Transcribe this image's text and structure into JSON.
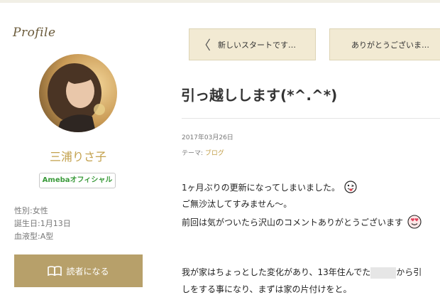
{
  "sidebar": {
    "heading": "Profile",
    "name": "三浦りさ子",
    "badge": "Amebaオフィシャル",
    "meta": [
      "性別:女性",
      "誕生日:1月13日",
      "血液型:A型"
    ],
    "follow_label": "読者になる",
    "follow_icon": "book-open-icon"
  },
  "nav": {
    "prev_label": "新しいスタートです…",
    "next_label": "ありがとうございま…",
    "prev_icon": "chevron-left-icon"
  },
  "post": {
    "title": "引っ越しします(*^.^*)",
    "date": "2017年03月26日",
    "theme_label": "テーマ:",
    "theme_link": "ブログ",
    "lines": [
      "1ヶ月ぶりの更新になってしまいました。",
      "ご無沙汰してすみません〜。",
      "前回は気がついたら沢山のコメントありがとうございます"
    ],
    "para2_a": "我が家はちょっとした変化があり、13年住んでた",
    "para2_b": "から引",
    "para2_line2": "しをする事になり、まずは家の片付けをと。"
  },
  "colors": {
    "accent": "#c3a14d",
    "button_bg": "#b7a06a",
    "nav_bg": "#f2ead3"
  }
}
